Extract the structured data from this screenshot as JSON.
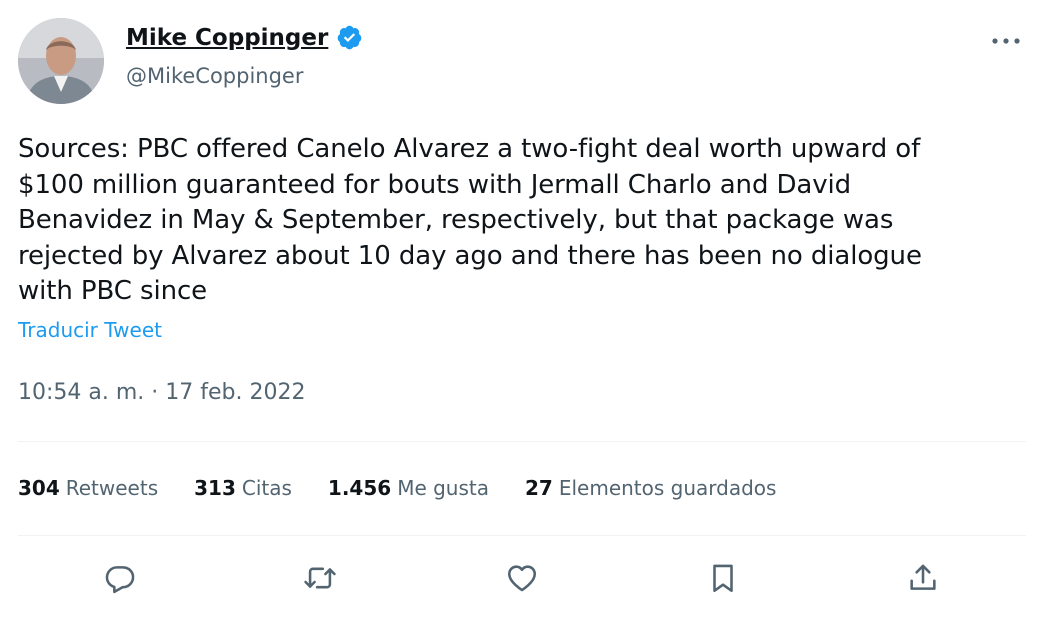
{
  "author": {
    "display_name": "Mike Coppinger",
    "handle": "@MikeCoppinger",
    "verified": true
  },
  "tweet": {
    "text": "Sources: PBC offered Canelo Alvarez a two-fight deal worth upward of\n$100 million guaranteed for bouts with Jermall Charlo and David\nBenavidez in May & September, respectively, but that package was\nrejected by Alvarez about 10 day ago and there has been no dialogue\nwith PBC since",
    "translate_label": "Traducir Tweet",
    "timestamp": "10:54 a. m. · 17 feb. 2022"
  },
  "stats": {
    "retweets_count": "304",
    "retweets_label": "Retweets",
    "quotes_count": "313",
    "quotes_label": "Citas",
    "likes_count": "1.456",
    "likes_label": "Me gusta",
    "bookmarks_count": "27",
    "bookmarks_label": "Elementos guardados"
  },
  "icons": {
    "more": "more-horizontal-icon",
    "verified": "verified-badge-icon",
    "reply": "reply-icon",
    "retweet": "retweet-icon",
    "like": "heart-icon",
    "bookmark": "bookmark-icon",
    "share": "share-icon"
  },
  "colors": {
    "accent": "#1d9bf0",
    "text": "#0f1419",
    "secondary": "#536471",
    "divider": "#eff3f4"
  }
}
